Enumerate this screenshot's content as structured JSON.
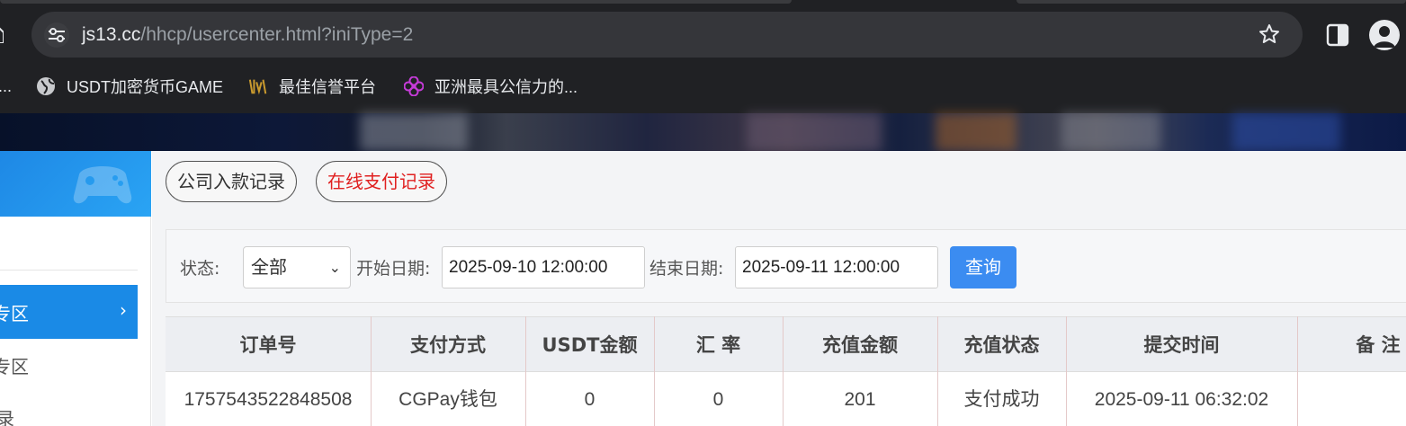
{
  "browser": {
    "url_host": "js13.cc",
    "url_path": "/hhcp/usercenter.html?iniType=2",
    "bookmarks": [
      {
        "label": "...",
        "icon": "bookmark-icon"
      },
      {
        "label": "USDT加密货币GAME",
        "icon": "globe-icon"
      },
      {
        "label": "最佳信誉平台",
        "icon": "site-logo-icon"
      },
      {
        "label": "亚洲最具公信力的...",
        "icon": "flower-icon"
      }
    ]
  },
  "sidebar": {
    "active_item": "专区",
    "active_item_visible": "专区",
    "item2": "专区",
    "item3": "录"
  },
  "tabs": [
    {
      "label": "公司入款记录",
      "active": false
    },
    {
      "label": "在线支付记录",
      "active": true
    }
  ],
  "filter": {
    "status_label": "状态:",
    "status_value": "全部",
    "start_label": "开始日期:",
    "start_value": "2025-09-10 12:00:00",
    "end_label": "结束日期:",
    "end_value": "2025-09-11 12:00:00",
    "query_button": "查询"
  },
  "table": {
    "headers": [
      "订单号",
      "支付方式",
      "USDT金额",
      "汇 率",
      "充值金额",
      "充值状态",
      "提交时间",
      "备 注"
    ],
    "rows": [
      [
        "1757543522848508",
        "CGPay钱包",
        "0",
        "0",
        "201",
        "支付成功",
        "2025-09-11 06:32:02",
        ""
      ]
    ]
  },
  "colors": {
    "accent_blue": "#1a8ae6",
    "query_blue": "#3b8cf1",
    "active_tab_red": "#e02020"
  }
}
